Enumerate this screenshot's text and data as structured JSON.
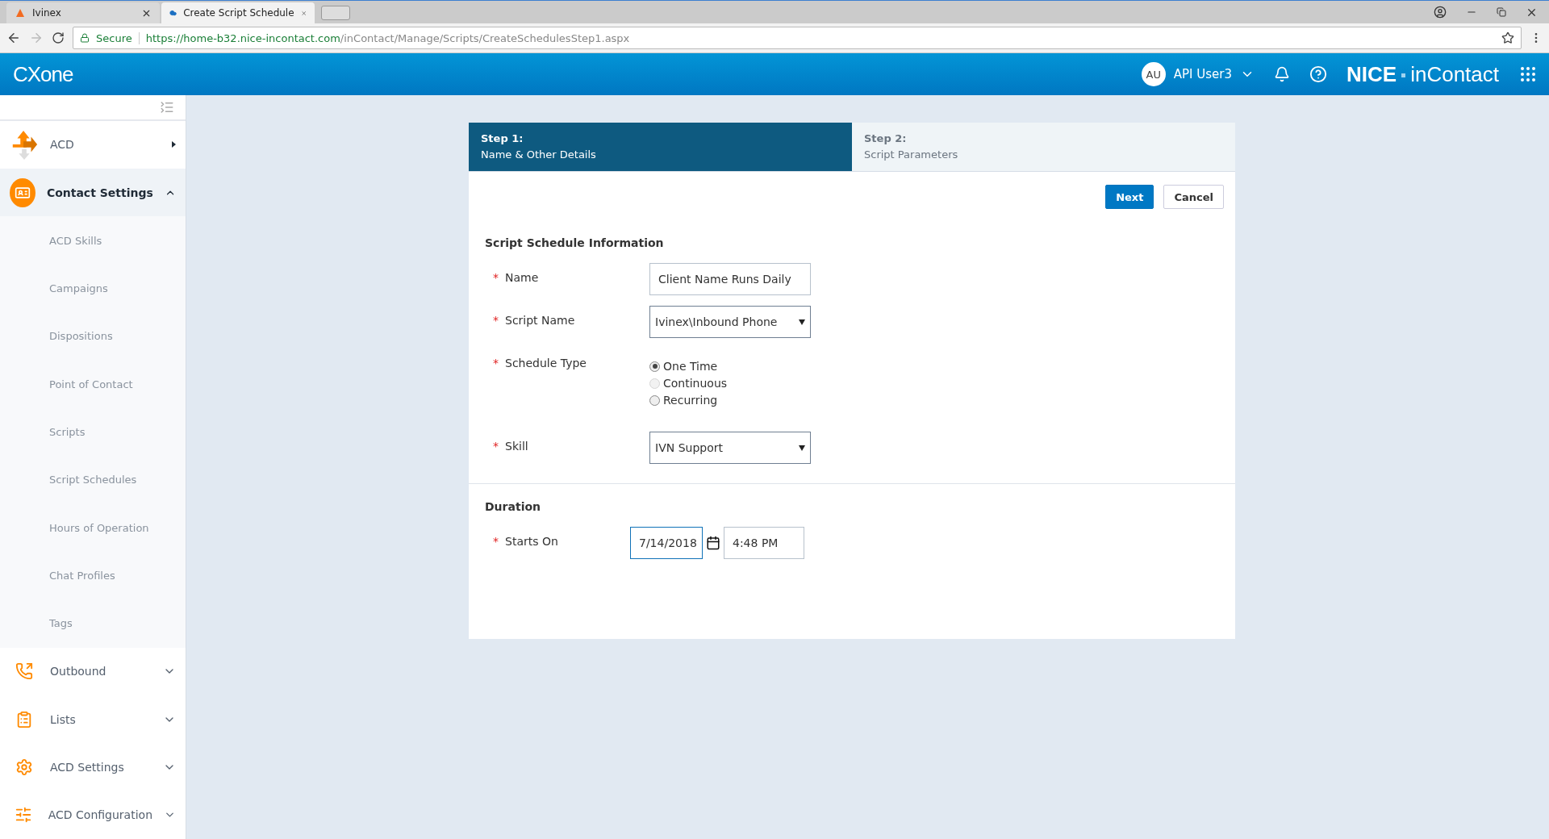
{
  "browser": {
    "tabs": [
      {
        "title": "Ivinex",
        "selected": false
      },
      {
        "title": "Create Script Schedule",
        "selected": true
      }
    ],
    "security": "Secure",
    "url": {
      "host": "https://home-b32.nice-incontact.com",
      "path": "/inContact/Manage/Scripts/CreateSchedulesStep1.aspx"
    }
  },
  "header": {
    "logo": "CXone",
    "user": {
      "initials": "AU",
      "name": "API User3"
    },
    "brand": {
      "first": "NICE",
      "second": "inContact"
    }
  },
  "sidebar": {
    "items": [
      {
        "label": "ACD",
        "kind": "flyout",
        "expanded": false
      },
      {
        "label": "Contact Settings",
        "kind": "group",
        "expanded": true,
        "children": [
          {
            "label": "ACD Skills"
          },
          {
            "label": "Campaigns"
          },
          {
            "label": "Dispositions"
          },
          {
            "label": "Point of Contact"
          },
          {
            "label": "Scripts"
          },
          {
            "label": "Script Schedules"
          },
          {
            "label": "Hours of Operation"
          },
          {
            "label": "Chat Profiles"
          },
          {
            "label": "Tags"
          }
        ]
      },
      {
        "label": "Outbound",
        "kind": "group",
        "expanded": false
      },
      {
        "label": "Lists",
        "kind": "group",
        "expanded": false
      },
      {
        "label": "ACD Settings",
        "kind": "group",
        "expanded": false
      },
      {
        "label": "ACD Configuration",
        "kind": "group",
        "expanded": false
      }
    ]
  },
  "wizard": {
    "steps": [
      {
        "step": "Step 1:",
        "title": "Name & Other Details",
        "selected": true
      },
      {
        "step": "Step 2:",
        "title": "Script Parameters",
        "selected": false
      }
    ],
    "buttons": [
      {
        "label": "Next",
        "kind": "primary"
      },
      {
        "label": "Cancel",
        "kind": "secondary"
      }
    ],
    "sections": [
      {
        "title": "Script Schedule Information",
        "fields": [
          {
            "label": "Name",
            "marker": "*",
            "kind": "text",
            "value": "Client Name Runs Daily"
          },
          {
            "label": "Script Name",
            "marker": "*",
            "kind": "select",
            "value": "Ivinex\\Inbound Phone"
          },
          {
            "label": "Schedule Type",
            "marker": "*",
            "kind": "radio",
            "options": [
              {
                "label": "One Time",
                "selected": true,
                "disabled": false
              },
              {
                "label": "Continuous",
                "selected": false,
                "disabled": true
              },
              {
                "label": "Recurring",
                "selected": false,
                "disabled": false
              }
            ]
          },
          {
            "label": "Skill",
            "marker": "*",
            "kind": "select",
            "value": "IVN Support"
          }
        ]
      },
      {
        "title": "Duration",
        "fields": [
          {
            "label": "Starts On",
            "marker": "*",
            "kind": "datetime",
            "date": "7/14/2018",
            "time": "4:48 PM"
          }
        ]
      }
    ]
  }
}
